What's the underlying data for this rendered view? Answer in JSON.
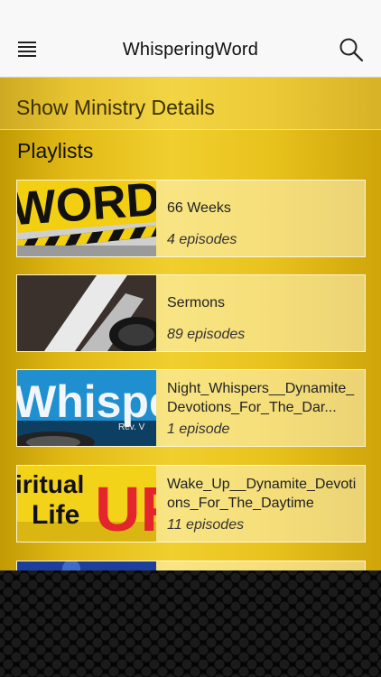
{
  "header": {
    "title": "WhisperingWord",
    "menu_icon": "hamburger-menu-icon",
    "search_icon": "search-icon"
  },
  "details_link": "Show Ministry Details",
  "section_title": "Playlists",
  "playlists": [
    {
      "title": "66 Weeks",
      "episodes": "4 episodes"
    },
    {
      "title": "Sermons",
      "episodes": "89 episodes"
    },
    {
      "title": "Night_Whispers__Dynamite_Devotions_For_The_Dar...",
      "episodes": "1 episode"
    },
    {
      "title": "Wake_Up__Dynamite_Devotions_For_The_Daytime",
      "episodes": "11 episodes"
    }
  ],
  "thumb_text": {
    "word": "WORD",
    "whispers": "Whisper",
    "whispers_small": "Rev. V",
    "spiritual": "iritual",
    "life": "Life",
    "up": "UP"
  },
  "colors": {
    "accent_gold": "#e9c31d",
    "header_bg": "#f8f8f8"
  }
}
